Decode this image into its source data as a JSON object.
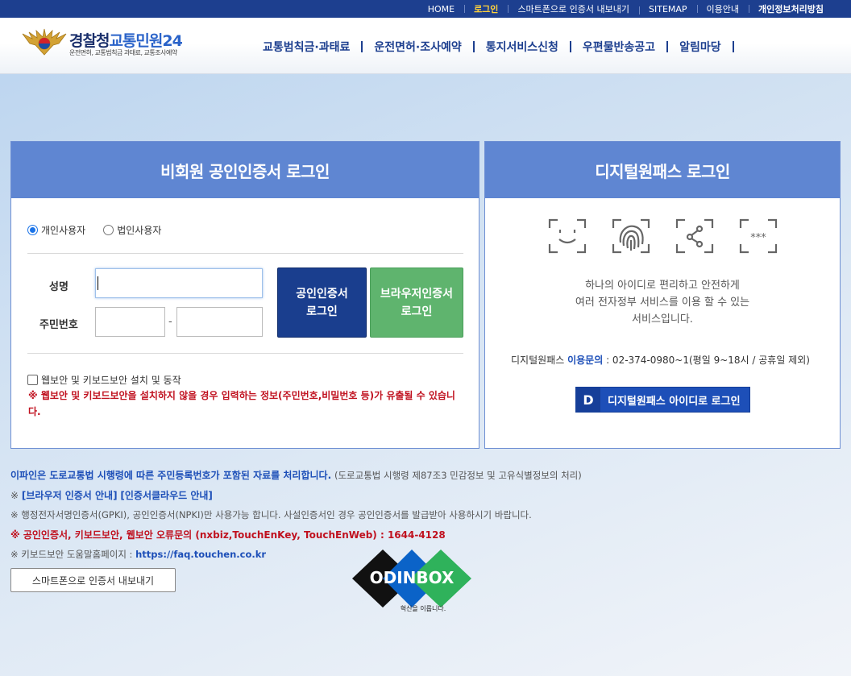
{
  "topbar": {
    "home": "HOME",
    "login": "로그인",
    "export_cert": "스마트폰으로 인증서 내보내기",
    "sitemap": "SITEMAP",
    "guide": "이용안내",
    "privacy": "개인정보처리방침"
  },
  "logo": {
    "name_part1": "경찰청",
    "name_part2": "교통민원24",
    "subtitle": "운전면허, 교통범칙금 과태료, 교통조사예약"
  },
  "nav": [
    "교통범칙금·과태료",
    "운전면허·조사예약",
    "통지서비스신청",
    "우편물반송공고",
    "알림마당"
  ],
  "left_panel": {
    "title": "비회원 공인인증서 로그인",
    "radio_personal": "개인사용자",
    "radio_corporate": "법인사용자",
    "radio_selected": "개인사용자",
    "name_label": "성명",
    "rrn_label": "주민번호",
    "name_value": "",
    "rrn_front_value": "",
    "rrn_back_value": "",
    "dash": "-",
    "btn_cert_line1": "공인인증서",
    "btn_cert_line2": "로그인",
    "btn_browser_line1": "브라우저인증서",
    "btn_browser_line2": "로그인",
    "security_checkbox": "웹보안 및 키보드보안 설치 및 동작",
    "warning": "※ 웹보안 및 키보드보안을 설치하지 않을 경우 입력하는 정보(주민번호,비밀번호 등)가 유출될 수 있습니다."
  },
  "right_panel": {
    "title": "디지털원패스 로그인",
    "icons": [
      "face-id-icon",
      "fingerprint-icon",
      "pattern-icon",
      "pin-icon"
    ],
    "desc_line1": "하나의 아이디로 편리하고 안전하게",
    "desc_line2": "여러 전자정부 서비스를 이용 할 수 있는",
    "desc_line3": "서비스입니다.",
    "contact_prefix": "디지털원패스",
    "contact_em": "이용문의",
    "contact_rest": ": 02-374-0980~1(평일 9~18시 / 공휴일 제외)",
    "btn_logo": "D",
    "btn_label": "디지털원패스 아이디로 로그인"
  },
  "notices": {
    "n1_bold": "이파인은 도로교통법 시행령에 따른 주민등록번호가 포함된 자료를 처리합니다.",
    "n1_gray": "(도로교통법 시행령 제87조3 민감정보 및 고유식별정보의 처리)",
    "n2_prefix": "※",
    "n2_link1": "[브라우저 인증서 안내]",
    "n2_link2": "[인증서클라우드 안내]",
    "n3": "※ 행정전자서명인증서(GPKI), 공인인증서(NPKI)만 사용가능 합니다. 사설인증서인 경우 공인인증서를 발급받아 사용하시기 바랍니다.",
    "n4": "※ 공인인증서, 키보드보안, 웹보안 오류문의 (nxbiz,TouchEnKey, TouchEnWeb) : 1644-4128",
    "n5_prefix": "※ 키보드보안 도움말홈페이지 :",
    "n5_link": "https://faq.touchen.co.kr"
  },
  "export_button": "스마트폰으로 인증서 내보내기",
  "odinbox": {
    "name": "ODINBOX",
    "tagline": "혁신을 이룹니다."
  },
  "colors": {
    "navy": "#1d3f8f",
    "panel_head": "#5f86d2",
    "green": "#5fb46e",
    "warning_red": "#c0111f",
    "link_blue": "#1d4fb8"
  }
}
